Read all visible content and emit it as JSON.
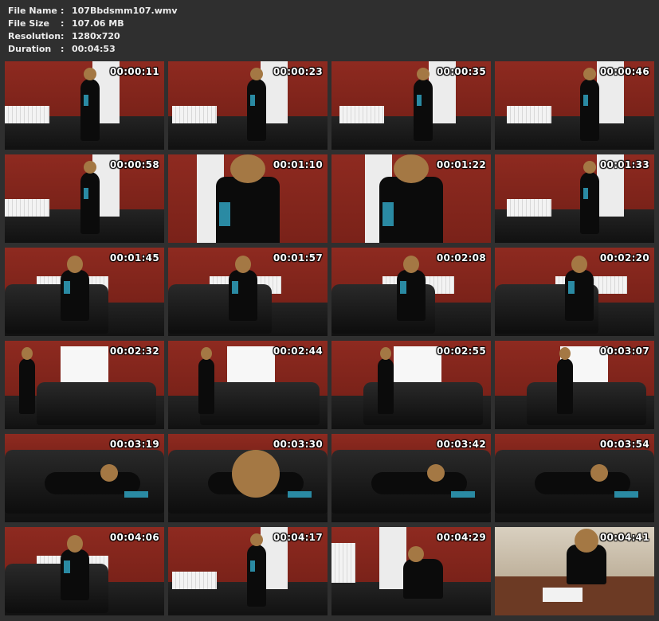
{
  "file_info": {
    "rows": [
      {
        "label": "File Name",
        "sep": ":",
        "value": "107Bbdsmm107.wmv"
      },
      {
        "label": "File Size",
        "sep": ":",
        "value": "107.06 MB"
      },
      {
        "label": "Resolution",
        "sep": ":",
        "value": "1280x720"
      },
      {
        "label": "Duration",
        "sep": ":",
        "value": "00:04:53"
      }
    ]
  },
  "thumbnails": [
    {
      "time": "00:00:11",
      "scene": "room-door"
    },
    {
      "time": "00:00:23",
      "scene": "room-door"
    },
    {
      "time": "00:00:35",
      "scene": "room-door"
    },
    {
      "time": "00:00:46",
      "scene": "room-door"
    },
    {
      "time": "00:00:58",
      "scene": "room-door"
    },
    {
      "time": "00:01:10",
      "scene": "closeup"
    },
    {
      "time": "00:01:22",
      "scene": "closeup"
    },
    {
      "time": "00:01:33",
      "scene": "room-door"
    },
    {
      "time": "00:01:45",
      "scene": "sofa"
    },
    {
      "time": "00:01:57",
      "scene": "sofa"
    },
    {
      "time": "00:02:08",
      "scene": "sofa"
    },
    {
      "time": "00:02:20",
      "scene": "sofa"
    },
    {
      "time": "00:02:32",
      "scene": "window-sofa"
    },
    {
      "time": "00:02:44",
      "scene": "window-sofa"
    },
    {
      "time": "00:02:55",
      "scene": "window-sofa"
    },
    {
      "time": "00:03:07",
      "scene": "window-sofa"
    },
    {
      "time": "00:03:19",
      "scene": "lying"
    },
    {
      "time": "00:03:30",
      "scene": "lying-close"
    },
    {
      "time": "00:03:42",
      "scene": "lying"
    },
    {
      "time": "00:03:54",
      "scene": "lying"
    },
    {
      "time": "00:04:06",
      "scene": "sofa"
    },
    {
      "time": "00:04:17",
      "scene": "room-door"
    },
    {
      "time": "00:04:29",
      "scene": "floor"
    },
    {
      "time": "00:04:41",
      "scene": "table"
    }
  ]
}
